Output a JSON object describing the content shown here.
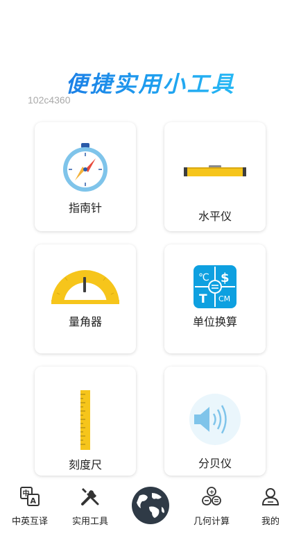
{
  "header": {
    "banner_title": "便捷实用小工具",
    "watermark": "102c4360"
  },
  "tools": [
    {
      "label": "指南针",
      "icon": "compass-icon"
    },
    {
      "label": "水平仪",
      "icon": "spirit-level-icon"
    },
    {
      "label": "量角器",
      "icon": "protractor-icon"
    },
    {
      "label": "单位换算",
      "icon": "unit-conversion-icon"
    },
    {
      "label": "刻度尺",
      "icon": "ruler-icon"
    },
    {
      "label": "分贝仪",
      "icon": "decibel-meter-icon"
    }
  ],
  "nav": {
    "items": [
      {
        "label": "中英互译",
        "icon": "translate-icon"
      },
      {
        "label": "实用工具",
        "icon": "tools-icon"
      },
      {
        "label": "",
        "icon": "globe-icon"
      },
      {
        "label": "几何计算",
        "icon": "geometry-icon"
      },
      {
        "label": "我的",
        "icon": "profile-icon"
      }
    ]
  },
  "colors": {
    "accent": "#1a8fe8",
    "yellow": "#f6c51b",
    "unit_blue": "#0ea0e0"
  }
}
